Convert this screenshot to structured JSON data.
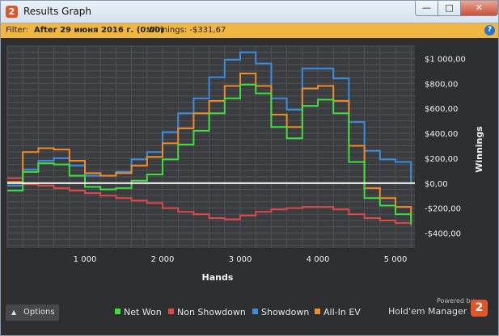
{
  "window": {
    "title": "Results Graph",
    "app_icon_label": "2"
  },
  "window_buttons": {
    "minimize": "—",
    "maximize": "□",
    "close": "✕"
  },
  "filter": {
    "label": "Filter:",
    "value": "After 29 июня 2016 г. (0:00)",
    "winnings": "Winnings: -$331,67"
  },
  "options": {
    "label": "Options"
  },
  "brand": {
    "powered_by": "Powered by",
    "name": "Hold'em Manager",
    "logo": "2"
  },
  "colors": {
    "net_won": "#3ee03e",
    "non_showdown": "#e04848",
    "showdown": "#3a8ee0",
    "all_in_ev": "#f28c28",
    "zero_line": "#ffffff"
  },
  "chart_data": {
    "type": "line",
    "xlabel": "Hands",
    "ylabel": "Winnings",
    "xlim": [
      0,
      5250
    ],
    "ylim": [
      -520,
      1100
    ],
    "x_ticks": [
      {
        "value": 1000,
        "label": "1 000"
      },
      {
        "value": 2000,
        "label": "2 000"
      },
      {
        "value": 3000,
        "label": "3 000"
      },
      {
        "value": 4000,
        "label": "4 000"
      },
      {
        "value": 5000,
        "label": "5 000"
      }
    ],
    "y_ticks": [
      {
        "value": 1000,
        "label": "$1 000,00"
      },
      {
        "value": 800,
        "label": "$800,00"
      },
      {
        "value": 600,
        "label": "$600,00"
      },
      {
        "value": 400,
        "label": "$400,00"
      },
      {
        "value": 200,
        "label": "$200,00"
      },
      {
        "value": 0,
        "label": "$0,00"
      },
      {
        "value": -200,
        "label": "-$200,00"
      },
      {
        "value": -400,
        "label": "-$400,00"
      }
    ],
    "grid": true,
    "legend_position": "bottom",
    "series": [
      {
        "name": "Net Won",
        "color": "#3ee03e",
        "x": [
          0,
          200,
          400,
          600,
          800,
          1000,
          1200,
          1400,
          1600,
          1800,
          2000,
          2200,
          2400,
          2600,
          2800,
          3000,
          3200,
          3400,
          3600,
          3800,
          4000,
          4200,
          4400,
          4600,
          4800,
          5000,
          5200
        ],
        "y": [
          -60,
          90,
          160,
          150,
          60,
          -30,
          -50,
          -40,
          20,
          70,
          190,
          310,
          420,
          560,
          680,
          790,
          720,
          450,
          360,
          620,
          670,
          560,
          170,
          -120,
          -180,
          -250,
          -330
        ]
      },
      {
        "name": "Non Showdown",
        "color": "#e04848",
        "x": [
          0,
          200,
          400,
          600,
          800,
          1000,
          1200,
          1400,
          1600,
          1800,
          2000,
          2200,
          2400,
          2600,
          2800,
          3000,
          3200,
          3400,
          3600,
          3800,
          4000,
          4200,
          4400,
          4600,
          4800,
          5000,
          5200
        ],
        "y": [
          40,
          -10,
          -20,
          -40,
          -60,
          -80,
          -100,
          -120,
          -140,
          -160,
          -200,
          -230,
          -250,
          -280,
          -290,
          -260,
          -230,
          -210,
          -200,
          -190,
          -190,
          -210,
          -250,
          -280,
          -300,
          -320,
          -340
        ]
      },
      {
        "name": "Showdown",
        "color": "#3a8ee0",
        "x": [
          0,
          200,
          400,
          600,
          800,
          1000,
          1200,
          1400,
          1600,
          1800,
          2000,
          2200,
          2400,
          2600,
          2800,
          3000,
          3200,
          3400,
          3600,
          3800,
          4000,
          4200,
          4400,
          4600,
          4800,
          5000,
          5200
        ],
        "y": [
          -20,
          110,
          180,
          200,
          140,
          60,
          60,
          90,
          190,
          250,
          410,
          560,
          680,
          850,
          990,
          1050,
          960,
          680,
          590,
          920,
          920,
          840,
          490,
          260,
          190,
          170,
          10
        ]
      },
      {
        "name": "All-In EV",
        "color": "#f28c28",
        "x": [
          0,
          200,
          400,
          600,
          800,
          1000,
          1200,
          1400,
          1600,
          1800,
          2000,
          2200,
          2400,
          2600,
          2800,
          3000,
          3200,
          3400,
          3600,
          3800,
          4000,
          4200,
          4400,
          4600,
          4800,
          5000,
          5200
        ],
        "y": [
          10,
          250,
          280,
          270,
          180,
          80,
          60,
          80,
          140,
          210,
          320,
          440,
          560,
          660,
          780,
          880,
          780,
          550,
          450,
          760,
          780,
          660,
          300,
          -40,
          -120,
          -190,
          -300
        ]
      }
    ]
  }
}
